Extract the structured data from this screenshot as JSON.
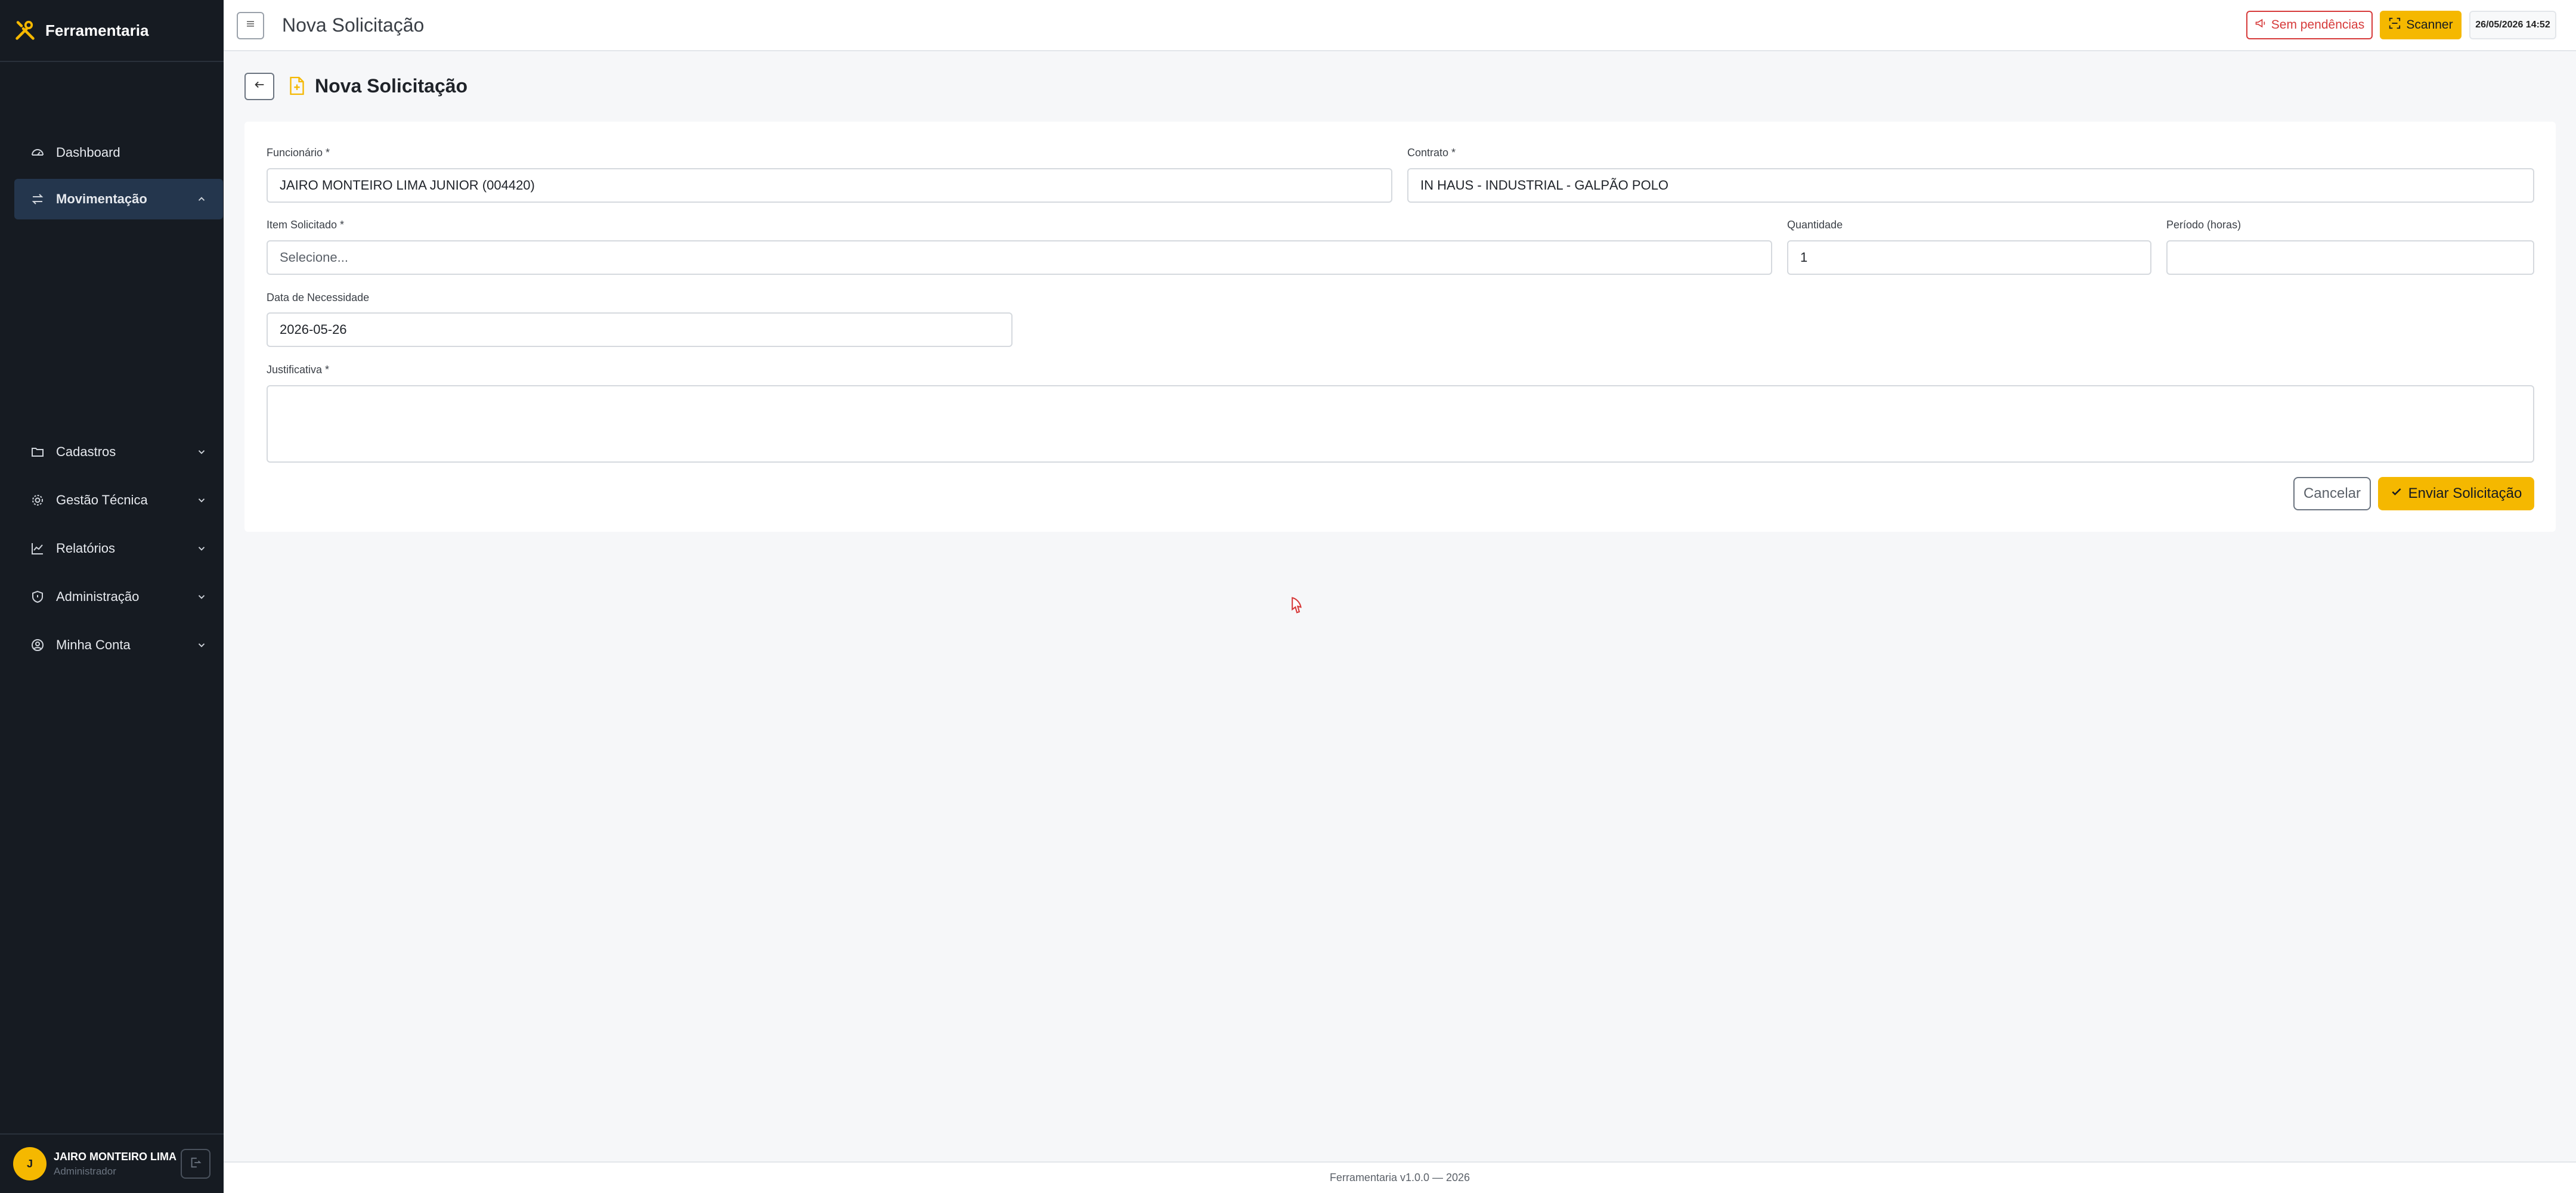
{
  "app": {
    "brand": "Ferramentaria"
  },
  "sidebar": {
    "items": [
      {
        "label": "Dashboard",
        "icon": "dashboard-gauge-icon"
      },
      {
        "label": "Movimentação",
        "icon": "swap-arrows-icon",
        "active": true,
        "expanded": true
      },
      {
        "label": "Cadastros",
        "icon": "folder-icon"
      },
      {
        "label": "Gestão Técnica",
        "icon": "gear-icon"
      },
      {
        "label": "Relatórios",
        "icon": "line-chart-icon"
      },
      {
        "label": "Administração",
        "icon": "shield-icon"
      },
      {
        "label": "Minha Conta",
        "icon": "user-circle-icon"
      }
    ],
    "user": {
      "initial": "J",
      "name": "JAIRO MONTEIRO LIMA",
      "role": "Administrador"
    }
  },
  "topbar": {
    "title": "Nova Solicitação",
    "pending_label": "Sem pendências",
    "scanner_label": "Scanner",
    "datetime": "26/05/2026 14:52"
  },
  "page": {
    "title": "Nova Solicitação"
  },
  "form": {
    "funcionario": {
      "label": "Funcionário *",
      "value": "JAIRO MONTEIRO LIMA JUNIOR (004420)"
    },
    "contrato": {
      "label": "Contrato *",
      "value": "IN HAUS - INDUSTRIAL - GALPÃO POLO"
    },
    "item": {
      "label": "Item Solicitado *",
      "placeholder": "Selecione..."
    },
    "quantidade": {
      "label": "Quantidade",
      "value": "1"
    },
    "periodo": {
      "label": "Período (horas)",
      "value": ""
    },
    "data": {
      "label": "Data de Necessidade",
      "value": "2026-05-26"
    },
    "justificativa": {
      "label": "Justificativa *",
      "value": ""
    },
    "cancel_label": "Cancelar",
    "submit_label": "Enviar Solicitação"
  },
  "footer": {
    "text": "Ferramentaria v1.0.0 — 2026"
  },
  "colors": {
    "accent": "#f5b800",
    "sidebar_bg": "#161b22",
    "active_bg": "#24364d",
    "danger": "#d63a3a"
  }
}
